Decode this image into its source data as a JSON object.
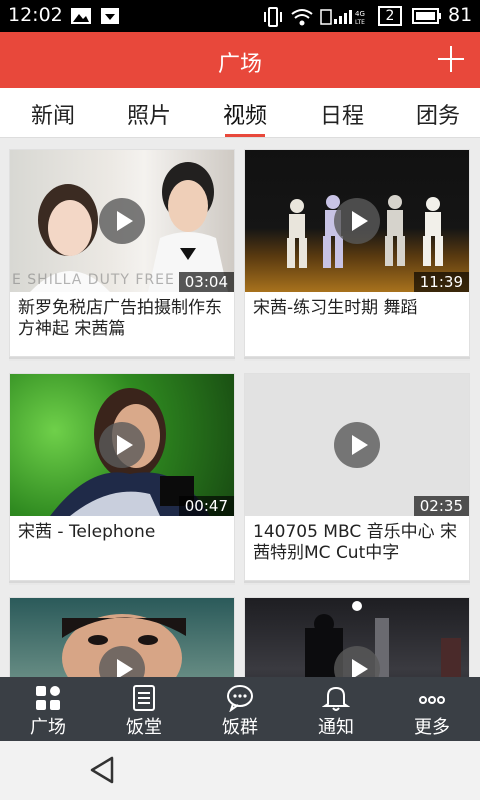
{
  "status_bar": {
    "time": "12:02",
    "battery": "81",
    "sim_badge": "2"
  },
  "app_bar": {
    "title": "广场"
  },
  "tabs": [
    {
      "label": "新闻"
    },
    {
      "label": "照片"
    },
    {
      "label": "视频",
      "active": true
    },
    {
      "label": "日程"
    },
    {
      "label": "团务"
    }
  ],
  "videos": [
    {
      "title": "新罗免税店广告拍摄制作东方神起 宋茜篇",
      "duration": "03:04",
      "watermark": "E SHILLA DUTY FREE"
    },
    {
      "title": "宋茜-练习生时期 舞蹈",
      "duration": "11:39"
    },
    {
      "title": "宋茜 - Telephone",
      "duration": "00:47"
    },
    {
      "title": "140705 MBC 音乐中心 宋茜特别MC Cut中字",
      "duration": "02:35"
    },
    {
      "title": "",
      "duration": ""
    },
    {
      "title": "",
      "duration": ""
    }
  ],
  "bottom_nav": [
    {
      "label": "广场",
      "icon": "grid-icon"
    },
    {
      "label": "饭堂",
      "icon": "document-icon"
    },
    {
      "label": "饭群",
      "icon": "chat-icon"
    },
    {
      "label": "通知",
      "icon": "bell-icon"
    },
    {
      "label": "更多",
      "icon": "more-icon"
    }
  ],
  "colors": {
    "accent": "#e8483b",
    "nav_bg": "#3a3f45"
  }
}
